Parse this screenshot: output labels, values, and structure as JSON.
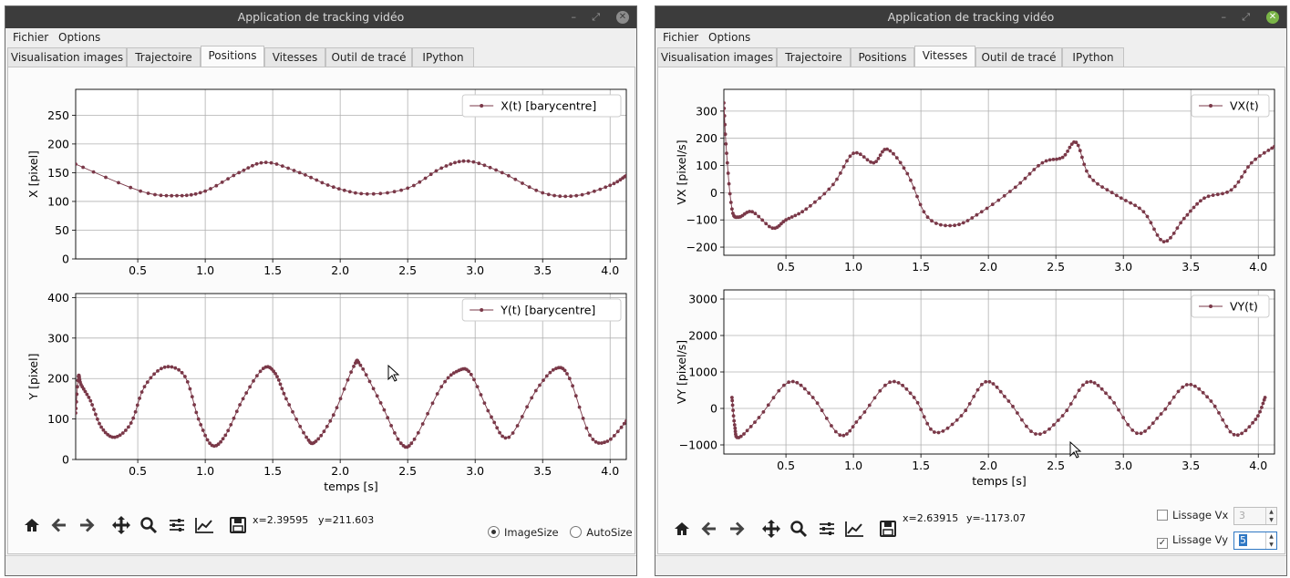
{
  "left": {
    "title": "Application de tracking vidéo",
    "menu": [
      "Fichier",
      "Options"
    ],
    "tabs": [
      "Visualisation images",
      "Trajectoire",
      "Positions",
      "Vitesses",
      "Outil de tracé",
      "IPython"
    ],
    "active_tab": "Positions",
    "coords": {
      "x": "x=2.39595",
      "y": "y=211.603"
    },
    "radio": {
      "image_size": "ImageSize",
      "auto_size": "AutoSize",
      "selected": "ImageSize"
    }
  },
  "right": {
    "title": "Application de tracking vidéo",
    "menu": [
      "Fichier",
      "Options"
    ],
    "tabs": [
      "Visualisation images",
      "Trajectoire",
      "Positions",
      "Vitesses",
      "Outil de tracé",
      "IPython"
    ],
    "active_tab": "Vitesses",
    "coords": {
      "x": "x=2.63915",
      "y": "y=-1173.07"
    },
    "lissage_vx": {
      "label": "Lissage Vx",
      "checked": false,
      "value": "3"
    },
    "lissage_vy": {
      "label": "Lissage Vy",
      "checked": true,
      "value": "5"
    }
  },
  "icons": [
    "home-icon",
    "back-arrow-icon",
    "forward-arrow-icon",
    "pan-icon",
    "zoom-icon",
    "subplots-config-icon",
    "edit-axis-icon",
    "save-icon"
  ],
  "colors": {
    "series": "#7a3848",
    "grid": "#b0b0b0",
    "titlebar": "#3c3c3c"
  },
  "chart_data": [
    {
      "type": "line",
      "window": "left",
      "legend": "X(t) [barycentre]",
      "legend_position": "top-right",
      "ylabel": "X [pixel]",
      "xlabel": "",
      "xlim": [
        0.04,
        4.12
      ],
      "ylim": [
        0,
        295
      ],
      "xticks": [
        0.5,
        1.0,
        1.5,
        2.0,
        2.5,
        3.0,
        3.5,
        4.0
      ],
      "xtick_labels": [
        "0.5",
        "1.0",
        "1.5",
        "2.0",
        "2.5",
        "3.0",
        "3.5",
        "4.0"
      ],
      "yticks": [
        0,
        50,
        100,
        150,
        200,
        250
      ],
      "ytick_labels": [
        "0",
        "50",
        "100",
        "150",
        "200",
        "250"
      ],
      "grid": true,
      "x": [
        0.04,
        0.52,
        0.79,
        1.0,
        1.25,
        1.45,
        1.7,
        1.95,
        2.2,
        2.5,
        2.75,
        2.95,
        3.2,
        3.5,
        3.75,
        4.0,
        4.12
      ],
      "y": [
        165,
        118,
        110,
        118,
        150,
        168,
        150,
        125,
        113,
        123,
        158,
        170,
        150,
        115,
        110,
        128,
        145
      ]
    },
    {
      "type": "line",
      "window": "left",
      "legend": "Y(t) [barycentre]",
      "legend_position": "top-right",
      "ylabel": "Y [pixel]",
      "xlabel": "temps [s]",
      "xlim": [
        0.04,
        4.12
      ],
      "ylim": [
        0,
        410
      ],
      "xticks": [
        0.5,
        1.0,
        1.5,
        2.0,
        2.5,
        3.0,
        3.5,
        4.0
      ],
      "xtick_labels": [
        "0.5",
        "1.0",
        "1.5",
        "2.0",
        "2.5",
        "3.0",
        "3.5",
        "4.0"
      ],
      "yticks": [
        0,
        100,
        200,
        300,
        400
      ],
      "ytick_labels": [
        "0",
        "100",
        "200",
        "300",
        "400"
      ],
      "grid": true,
      "x": [
        0.04,
        0.06,
        0.08,
        0.15,
        0.23,
        0.33,
        0.45,
        0.55,
        0.7,
        0.85,
        0.95,
        1.05,
        1.15,
        1.28,
        1.43,
        1.52,
        1.6,
        1.75,
        1.82,
        1.95,
        2.1,
        2.15,
        2.3,
        2.45,
        2.55,
        2.75,
        2.88,
        2.97,
        3.12,
        3.25,
        3.45,
        3.6,
        3.7,
        3.85,
        3.98,
        4.12
      ],
      "y": [
        115,
        205,
        185,
        145,
        80,
        55,
        90,
        180,
        228,
        205,
        100,
        35,
        60,
        150,
        225,
        212,
        150,
        55,
        45,
        110,
        230,
        233,
        140,
        40,
        50,
        180,
        220,
        210,
        105,
        55,
        170,
        225,
        200,
        60,
        45,
        95
      ]
    },
    {
      "type": "line",
      "window": "right",
      "legend": "VX(t)",
      "legend_position": "top-right",
      "ylabel": "VX [pixel/s]",
      "xlabel": "",
      "xlim": [
        0.04,
        4.12
      ],
      "ylim": [
        -230,
        380
      ],
      "xticks": [
        0.5,
        1.0,
        1.5,
        2.0,
        2.5,
        3.0,
        3.5,
        4.0
      ],
      "xtick_labels": [
        "0.5",
        "1.0",
        "1.5",
        "2.0",
        "2.5",
        "3.0",
        "3.5",
        "4.0"
      ],
      "yticks": [
        -200,
        -100,
        0,
        100,
        200,
        300
      ],
      "ytick_labels": [
        "−200",
        "−100",
        "0",
        "100",
        "200",
        "300"
      ],
      "grid": true,
      "x": [
        0.04,
        0.06,
        0.1,
        0.15,
        0.25,
        0.4,
        0.5,
        0.65,
        0.85,
        1.0,
        1.15,
        1.25,
        1.4,
        1.55,
        1.75,
        1.95,
        2.2,
        2.4,
        2.55,
        2.65,
        2.75,
        2.95,
        3.15,
        3.3,
        3.45,
        3.6,
        3.8,
        3.95,
        4.12
      ],
      "y": [
        330,
        145,
        -60,
        -90,
        -70,
        -130,
        -100,
        -60,
        30,
        145,
        110,
        160,
        70,
        -90,
        -120,
        -70,
        20,
        110,
        130,
        185,
        60,
        -10,
        -70,
        -180,
        -95,
        -20,
        10,
        110,
        170
      ]
    },
    {
      "type": "line",
      "window": "right",
      "legend": "VY(t)",
      "legend_position": "top-right",
      "ylabel": "VY [pixel/s]",
      "xlabel": "temps [s]",
      "xlim": [
        0.04,
        4.12
      ],
      "ylim": [
        -1250,
        3250
      ],
      "xticks": [
        0.5,
        1.0,
        1.5,
        2.0,
        2.5,
        3.0,
        3.5,
        4.0
      ],
      "xtick_labels": [
        "0.5",
        "1.0",
        "1.5",
        "2.0",
        "2.5",
        "3.0",
        "3.5",
        "4.0"
      ],
      "yticks": [
        -1000,
        0,
        1000,
        2000,
        3000
      ],
      "ytick_labels": [
        "−1000",
        "0",
        "1000",
        "2000",
        "3000"
      ],
      "grid": true,
      "x": [
        0.1,
        0.12,
        0.15,
        0.3,
        0.52,
        0.7,
        0.9,
        1.05,
        1.27,
        1.45,
        1.6,
        1.8,
        1.98,
        2.15,
        2.35,
        2.55,
        2.73,
        2.9,
        3.1,
        3.28,
        3.47,
        3.65,
        3.82,
        3.98,
        4.05
      ],
      "y": [
        300,
        -450,
        -800,
        -250,
        720,
        300,
        -730,
        -250,
        720,
        300,
        -650,
        -200,
        730,
        200,
        -700,
        -200,
        720,
        300,
        -680,
        -150,
        650,
        200,
        -720,
        -300,
        300
      ]
    }
  ]
}
